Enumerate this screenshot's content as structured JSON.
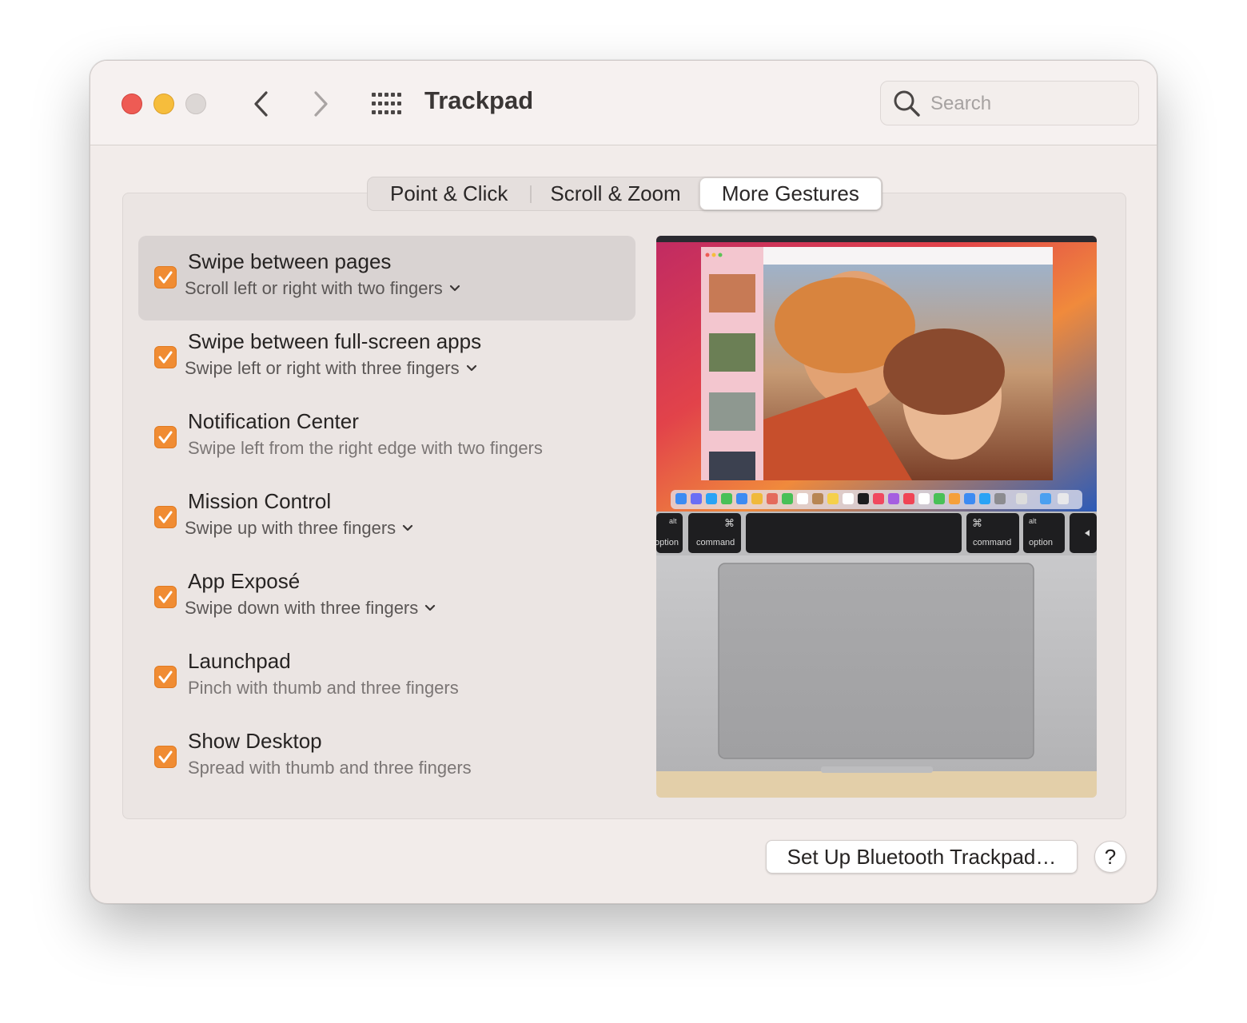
{
  "window": {
    "title": "Trackpad",
    "traffic_lights": {
      "close": "#ee5b54",
      "minimize": "#f6bd3c",
      "zoom": "#dcd7d5"
    }
  },
  "search": {
    "placeholder": "Search"
  },
  "tabs": [
    {
      "label": "Point & Click",
      "selected": false
    },
    {
      "label": "Scroll & Zoom",
      "selected": false
    },
    {
      "label": "More Gestures",
      "selected": true
    }
  ],
  "gestures": [
    {
      "title": "Swipe between pages",
      "subtitle": "Scroll left or right with two fingers",
      "checked": true,
      "has_menu": true,
      "selected": true
    },
    {
      "title": "Swipe between full-screen apps",
      "subtitle": "Swipe left or right with three fingers",
      "checked": true,
      "has_menu": true
    },
    {
      "title": "Notification Center",
      "subtitle": "Swipe left from the right edge with two fingers",
      "checked": true,
      "has_menu": false
    },
    {
      "title": "Mission Control",
      "subtitle": "Swipe up with three fingers",
      "checked": true,
      "has_menu": true
    },
    {
      "title": "App Exposé",
      "subtitle": "Swipe down with three fingers",
      "checked": true,
      "has_menu": true
    },
    {
      "title": "Launchpad",
      "subtitle": "Pinch with thumb and three fingers",
      "checked": true,
      "has_menu": false
    },
    {
      "title": "Show Desktop",
      "subtitle": "Spread with thumb and three fingers",
      "checked": true,
      "has_menu": false
    }
  ],
  "preview_keys": {
    "left_alt": "alt",
    "left_option": "option",
    "left_cmd_symbol": "⌘",
    "left_command": "command",
    "right_cmd_symbol": "⌘",
    "right_command": "command",
    "right_alt": "alt",
    "right_option": "option"
  },
  "footer": {
    "setup_button": "Set Up Bluetooth Trackpad…",
    "help_button": "?"
  },
  "colors": {
    "accent": "#f08c33",
    "window_bg": "#f2ecea"
  }
}
